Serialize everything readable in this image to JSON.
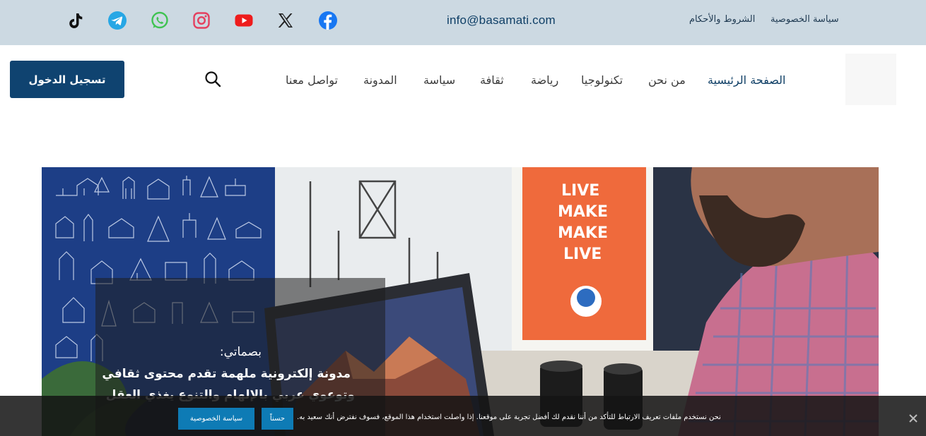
{
  "topbar": {
    "email": "info@basamati.com",
    "links": [
      "سياسة الخصوصية",
      "الشروط والأحكام"
    ],
    "social_icons": [
      "tiktok-icon",
      "telegram-icon",
      "whatsapp-icon",
      "instagram-icon",
      "youtube-icon",
      "x-icon",
      "facebook-icon"
    ]
  },
  "nav": {
    "items": [
      "الصفحة الرئيسية",
      "من نحن",
      "تكنولوجيا",
      "رياضة",
      "ثقافة",
      "سياسة",
      "المدونة",
      "تواصل معنا"
    ],
    "active": "الصفحة الرئيسية"
  },
  "header": {
    "login_label": "تسجيل الدخول"
  },
  "hero": {
    "label": "بصماتي:",
    "line1": "مدونة إلكترونية ملهمة تقدم محتوى ثقافي",
    "line2": "وتوعوي عربي بالإلهام والتنوع يغذي العقل"
  },
  "cookie": {
    "text": "نحن نستخدم ملفات تعريف الارتباط للتأكد من أننا نقدم لك أفضل تجربة على موقعنا. إذا واصلت استخدام هذا الموقع، فسوف نفترض أنك سعيد به.",
    "accept_label": "حسناً",
    "privacy_label": "سياسة الخصوصية"
  },
  "colors": {
    "topbar_bg": "#ccd9e2",
    "brand": "#0f4370",
    "cookie_button": "#0e7bb5"
  }
}
